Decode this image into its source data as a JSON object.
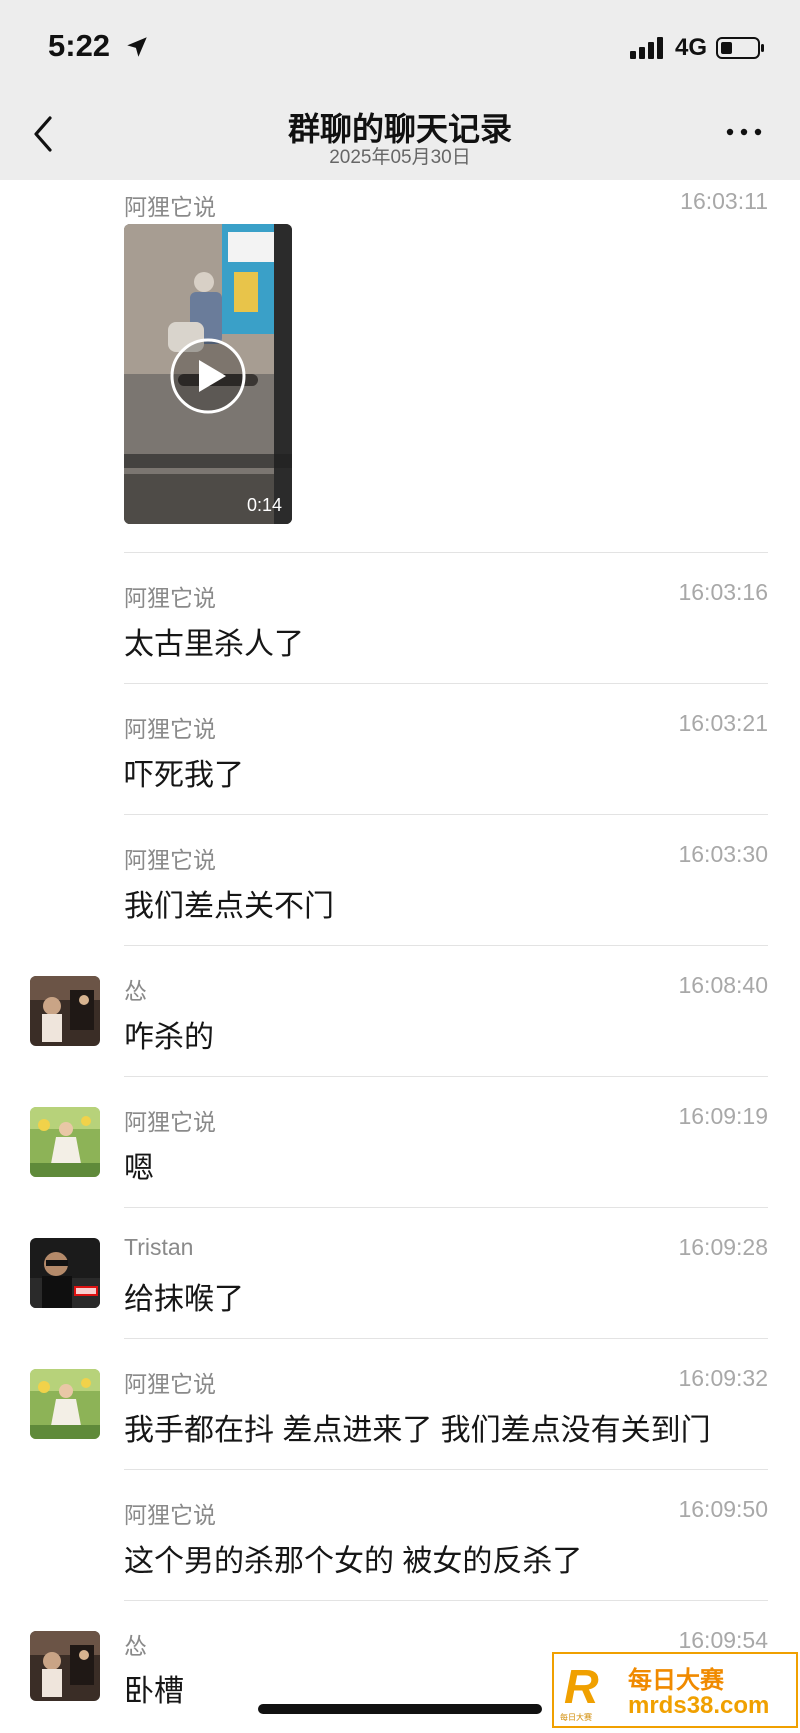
{
  "status_bar": {
    "time": "5:22",
    "network": "4G"
  },
  "nav": {
    "title": "群聊的聊天记录",
    "subtitle": "2025年05月30日"
  },
  "messages": [
    {
      "sender": "阿狸它说",
      "time": "16:03:11",
      "video_duration": "0:14"
    },
    {
      "sender": "阿狸它说",
      "time": "16:03:16",
      "text": "太古里杀人了"
    },
    {
      "sender": "阿狸它说",
      "time": "16:03:21",
      "text": "吓死我了"
    },
    {
      "sender": "阿狸它说",
      "time": "16:03:30",
      "text": "我们差点关不门"
    },
    {
      "sender": "怂",
      "time": "16:08:40",
      "text": "咋杀的"
    },
    {
      "sender": "阿狸它说",
      "time": "16:09:19",
      "text": "嗯"
    },
    {
      "sender": "Tristan",
      "time": "16:09:28",
      "text": "给抹喉了"
    },
    {
      "sender": "阿狸它说",
      "time": "16:09:32",
      "text": "我手都在抖 差点进来了 我们差点没有关到门"
    },
    {
      "sender": "阿狸它说",
      "time": "16:09:50",
      "text": "这个男的杀那个女的 被女的反杀了"
    },
    {
      "sender": "怂",
      "time": "16:09:54",
      "text": "卧槽"
    }
  ],
  "watermark": {
    "logo": "R",
    "logo_sub": "每日大赛",
    "name": "每日大赛",
    "url": "mrds38.com"
  },
  "colors": {
    "header_bg": "#ededed",
    "watermark": "#f0a000"
  },
  "icons": [
    "location-arrow-icon",
    "signal-icon",
    "battery-icon",
    "back-chevron-icon",
    "more-dots-icon",
    "play-icon"
  ]
}
